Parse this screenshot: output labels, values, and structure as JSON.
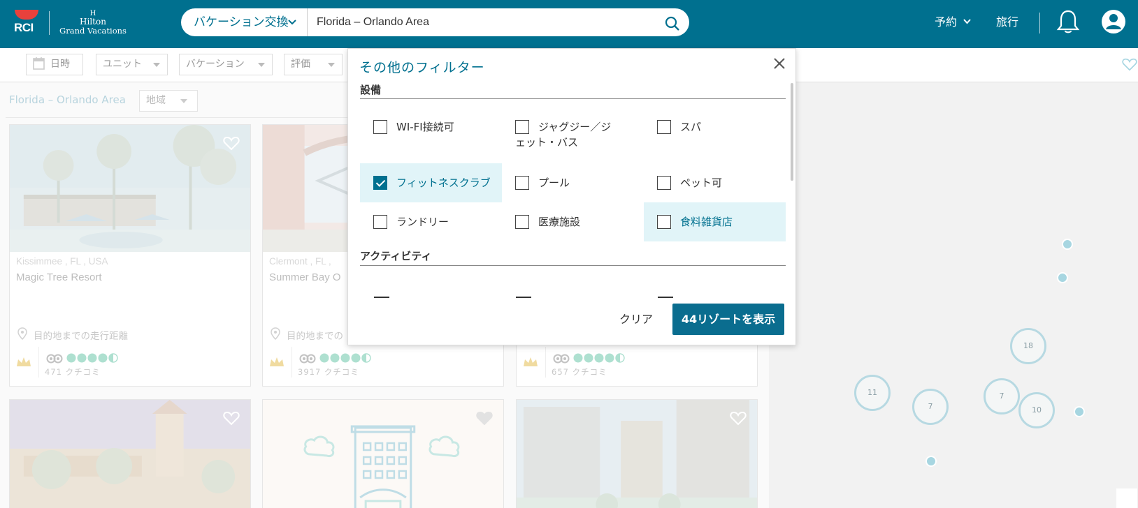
{
  "header": {
    "brand_rci": "RCI",
    "brand_hilton_mark": "H",
    "brand_hilton_line1": "Hilton",
    "brand_hilton_line2": "Grand Vacations",
    "search_type": "バケーション交換",
    "search_value": "Florida – Orlando Area",
    "nav_reservations": "予約",
    "nav_travel": "旅行",
    "icons": [
      "chevron-down-icon",
      "search-icon",
      "bell-icon",
      "account-icon"
    ],
    "color_primary": "#00708f",
    "color_brand_red": "#e8413c"
  },
  "filter_bar": {
    "date": "日時",
    "unit": "ユニット",
    "vacation": "バケーション",
    "rating": "評価"
  },
  "results": {
    "location_title": "Florida – Orlando Area",
    "region_chip": "地域",
    "cards": [
      {
        "location": "Kissimmee , FL , USA",
        "name": "Magic Tree Resort",
        "distance": "目的地までの走行距離",
        "reviews": "471 クチコミ",
        "rating": 4.5
      },
      {
        "location": "Clermont , FL ,",
        "name": "Summer Bay O",
        "distance": "目的地までの",
        "reviews": "3917 クチコミ",
        "rating": 4.5
      },
      {
        "location": "",
        "name": "",
        "distance": "",
        "reviews": "657 クチコミ",
        "rating": 4.5
      }
    ]
  },
  "map": {
    "clusters": [
      "18",
      "11",
      "7",
      "7",
      "10"
    ]
  },
  "modal": {
    "title": "その他のフィルター",
    "amenities_title": "設備",
    "activities_title": "アクティビティ",
    "options": [
      {
        "label": "WI-FI接続可",
        "checked": false
      },
      {
        "label": "ジャグジー／ジェット・バス",
        "checked": false
      },
      {
        "label": "スパ",
        "checked": false
      },
      {
        "label": "フィットネスクラブ",
        "checked": true
      },
      {
        "label": "プール",
        "checked": false
      },
      {
        "label": "ペット可",
        "checked": false
      },
      {
        "label": "ランドリー",
        "checked": false
      },
      {
        "label": "医療施設",
        "checked": false
      },
      {
        "label": "食料雑貨店",
        "checked": false
      }
    ],
    "clear_label": "クリア",
    "show_label": "44リゾートを表示"
  }
}
